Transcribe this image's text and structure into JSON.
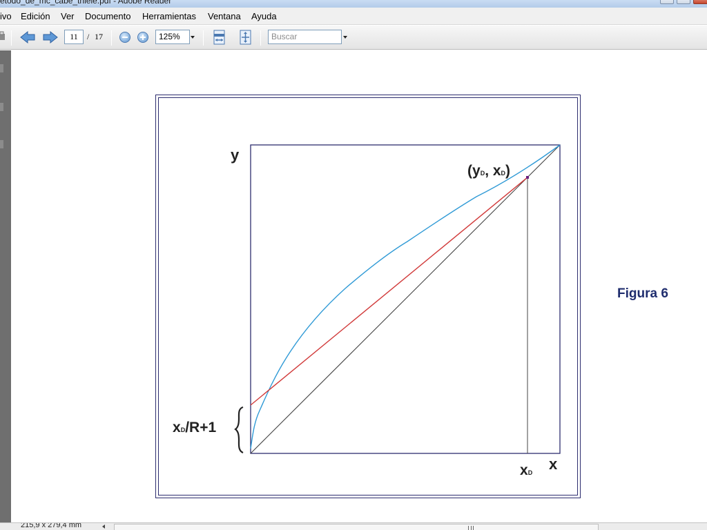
{
  "window": {
    "title": "etodo_de_mc_cabe_thiele.pdf - Adobe Reader"
  },
  "menu": {
    "items": [
      "ivo",
      "Edición",
      "Ver",
      "Documento",
      "Herramientas",
      "Ventana",
      "Ayuda"
    ]
  },
  "toolbar": {
    "page_current": "11",
    "page_separator": "/",
    "page_total": "17",
    "zoom": "125%",
    "search_placeholder": "Buscar",
    "icons": [
      "print-icon",
      "previous-page-icon",
      "next-page-icon",
      "zoom-out-icon",
      "zoom-in-icon",
      "fit-width-icon",
      "fit-page-icon"
    ]
  },
  "figure": {
    "caption": "Figura 6",
    "y_axis_label": "y",
    "x_axis_label": "x",
    "point_label_open": "(y",
    "point_label_sub1": "D",
    "point_label_mid": ", x",
    "point_label_sub2": "D",
    "point_label_close": ")",
    "x_tick_main": "x",
    "x_tick_sub": "D",
    "intercept_main": "x",
    "intercept_sub": "D",
    "intercept_rest": "/R+1",
    "colors": {
      "equilibrium_curve": "#2f9ad6",
      "operating_line": "#d13a3a",
      "diagonal": "#444444",
      "frame": "#2c2c6e"
    }
  },
  "statusbar": {
    "page_size": "215,9 x 279,4 mm"
  }
}
